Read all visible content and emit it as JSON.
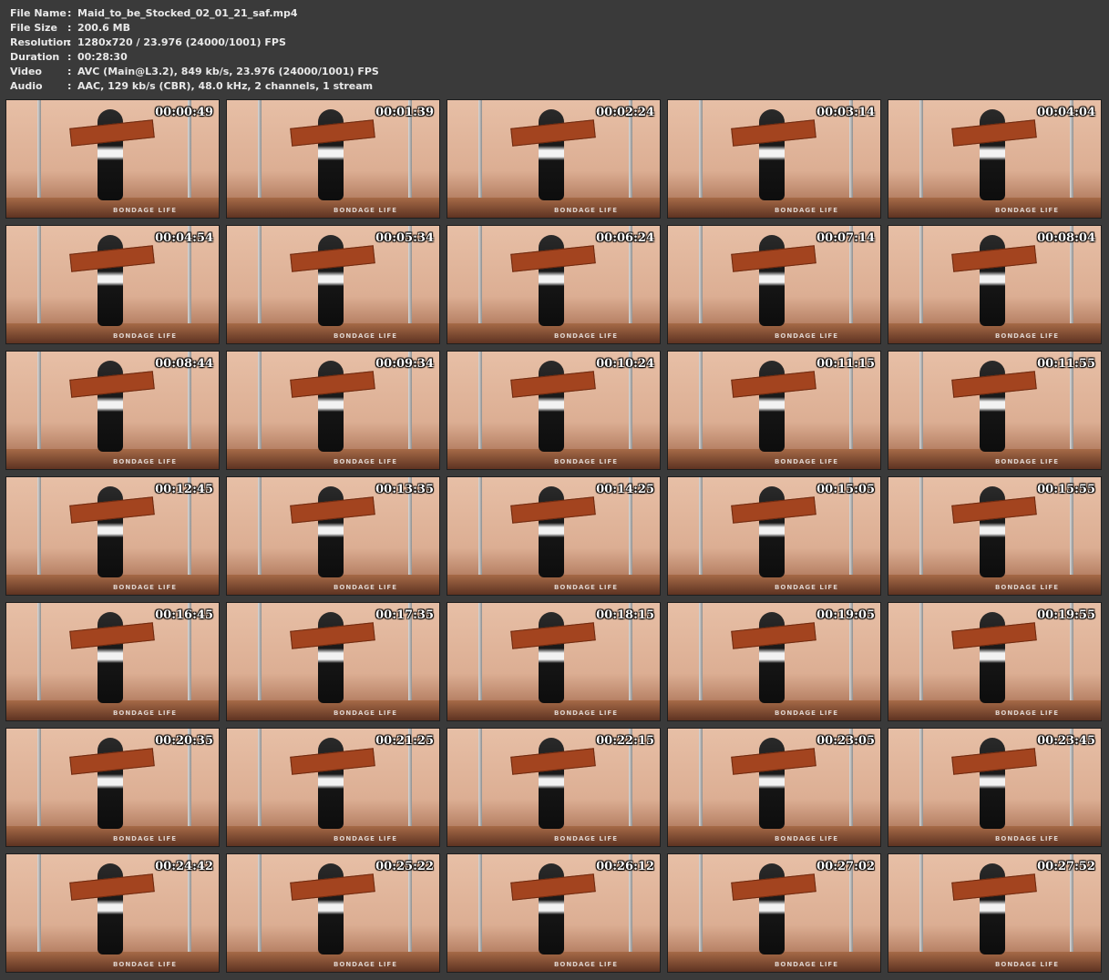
{
  "file_info": [
    {
      "key": "File Name",
      "value": "Maid_to_be_Stocked_02_01_21_saf.mp4"
    },
    {
      "key": "File Size",
      "value": "200.6 MB"
    },
    {
      "key": "Resolution",
      "value": "1280x720 / 23.976 (24000/1001) FPS"
    },
    {
      "key": "Duration",
      "value": "00:28:30"
    },
    {
      "key": "Video",
      "value": "AVC (Main@L3.2), 849 kb/s, 23.976 (24000/1001) FPS"
    },
    {
      "key": "Audio",
      "value": "AAC, 129 kb/s (CBR), 48.0 kHz, 2 channels, 1 stream"
    }
  ],
  "separator": ":",
  "watermark": "BONDAGE LIFE",
  "thumbnails": [
    "00:00:49",
    "00:01:39",
    "00:02:24",
    "00:03:14",
    "00:04:04",
    "00:04:54",
    "00:05:34",
    "00:06:24",
    "00:07:14",
    "00:08:04",
    "00:08:44",
    "00:09:34",
    "00:10:24",
    "00:11:15",
    "00:11:55",
    "00:12:45",
    "00:13:35",
    "00:14:25",
    "00:15:05",
    "00:15:55",
    "00:16:45",
    "00:17:35",
    "00:18:15",
    "00:19:05",
    "00:19:55",
    "00:20:35",
    "00:21:25",
    "00:22:15",
    "00:23:05",
    "00:23:45",
    "00:24:42",
    "00:25:22",
    "00:26:12",
    "00:27:02",
    "00:27:52"
  ]
}
